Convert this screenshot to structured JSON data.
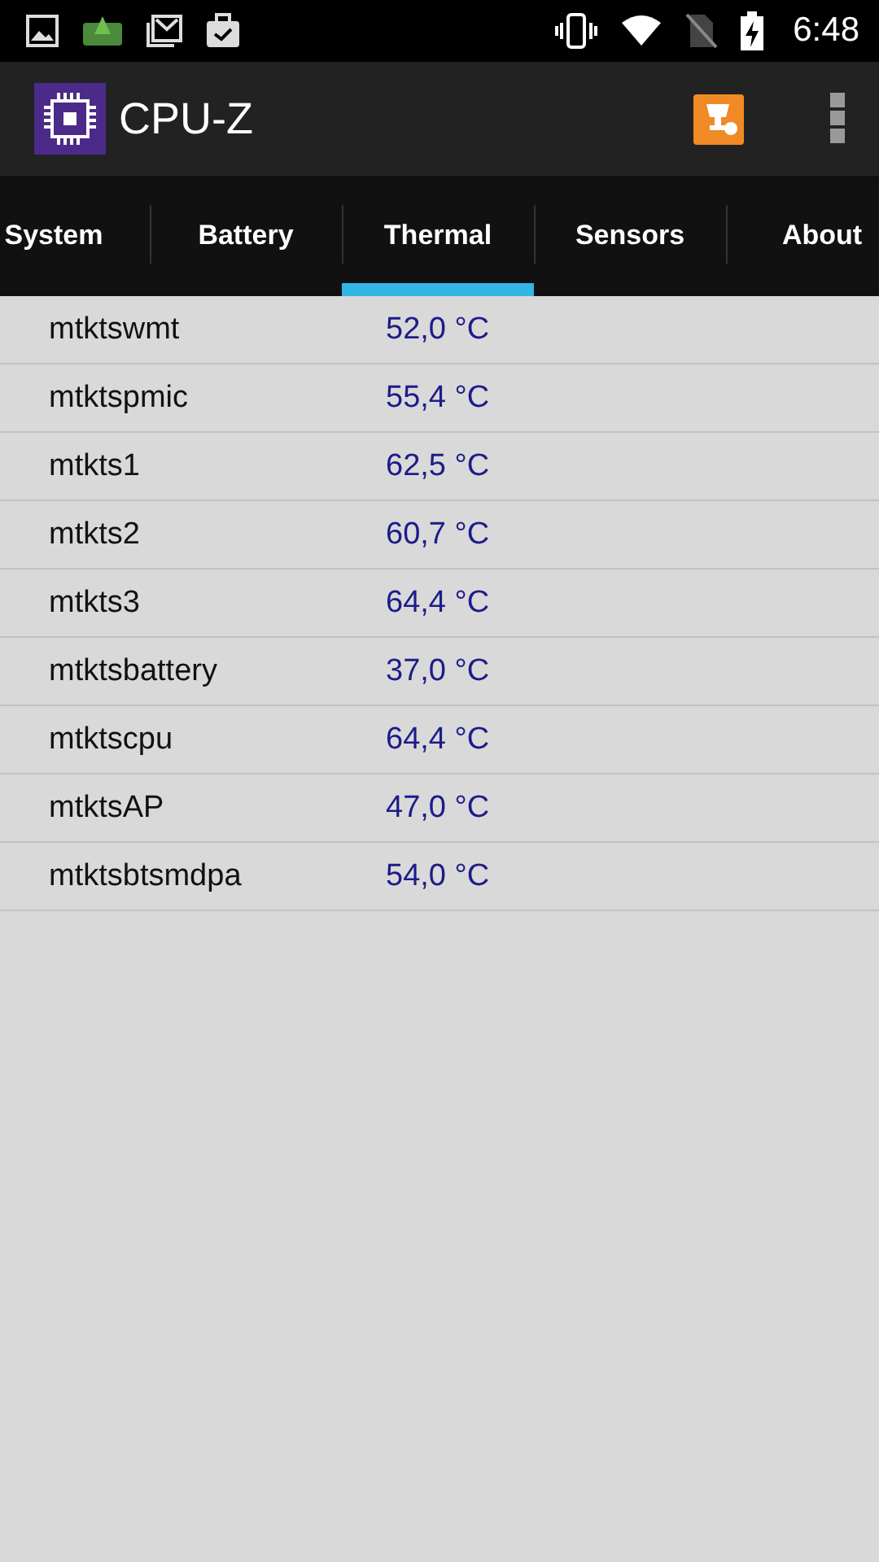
{
  "status_bar": {
    "time": "6:48"
  },
  "app_bar": {
    "title": "CPU-Z"
  },
  "tabs": [
    {
      "label": "System",
      "selected": false
    },
    {
      "label": "Battery",
      "selected": false
    },
    {
      "label": "Thermal",
      "selected": true
    },
    {
      "label": "Sensors",
      "selected": false
    },
    {
      "label": "About",
      "selected": false
    }
  ],
  "sensors": [
    {
      "name": "mtktswmt",
      "value": "52,0 °C"
    },
    {
      "name": "mtktspmic",
      "value": "55,4 °C"
    },
    {
      "name": "mtkts1",
      "value": "62,5 °C"
    },
    {
      "name": "mtkts2",
      "value": "60,7 °C"
    },
    {
      "name": "mtkts3",
      "value": "64,4 °C"
    },
    {
      "name": "mtktsbattery",
      "value": "37,0 °C"
    },
    {
      "name": "mtktscpu",
      "value": "64,4 °C"
    },
    {
      "name": "mtktsAP",
      "value": "47,0 °C"
    },
    {
      "name": "mtktsbtsmdpa",
      "value": "54,0 °C"
    }
  ]
}
